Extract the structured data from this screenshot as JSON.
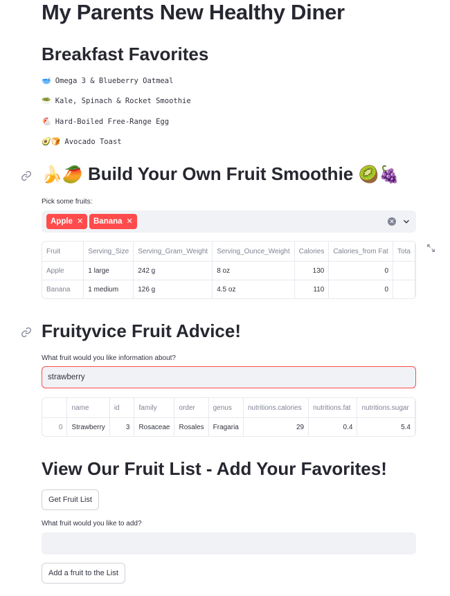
{
  "page_title": "My Parents New Healthy Diner",
  "breakfast": {
    "heading": "Breakfast Favorites",
    "items": [
      {
        "emoji": "🥣",
        "text": "Omega 3 & Blueberry Oatmeal"
      },
      {
        "emoji": "🥗",
        "text": "Kale, Spinach & Rocket Smoothie"
      },
      {
        "emoji": "🐔",
        "text": "Hard-Boiled Free-Range Egg"
      },
      {
        "emoji": "🥑🍞",
        "text": "Avocado Toast"
      }
    ]
  },
  "smoothie": {
    "heading_emoji_left": "🍌🥭",
    "heading": "Build Your Own Fruit Smoothie",
    "heading_emoji_right": "🥝🍇",
    "picker_label": "Pick some fruits:",
    "selected": [
      "Apple",
      "Banana"
    ],
    "table": {
      "columns": [
        "Fruit",
        "Serving_Size",
        "Serving_Gram_Weight",
        "Serving_Ounce_Weight",
        "Calories",
        "Calories_from Fat",
        "Tota"
      ],
      "rows": [
        [
          "Apple",
          "1 large",
          "242 g",
          "8 oz",
          "130",
          "0",
          ""
        ],
        [
          "Banana",
          "1 medium",
          "126 g",
          "4.5 oz",
          "110",
          "0",
          ""
        ]
      ]
    }
  },
  "advice": {
    "heading": "Fruityvice Fruit Advice!",
    "input_label": "What fruit would you like information about?",
    "input_value": "strawberry",
    "table": {
      "columns": [
        "",
        "name",
        "id",
        "family",
        "order",
        "genus",
        "nutritions.calories",
        "nutritions.fat",
        "nutritions.sugar"
      ],
      "rows": [
        [
          "0",
          "Strawberry",
          "3",
          "Rosaceae",
          "Rosales",
          "Fragaria",
          "29",
          "0.4",
          "5.4"
        ]
      ]
    }
  },
  "fruit_list": {
    "heading": "View Our Fruit List - Add Your Favorites!",
    "get_button": "Get Fruit List",
    "add_label": "What fruit would you like to add?",
    "add_input_value": "",
    "add_button": "Add a fruit to the List"
  },
  "colors": {
    "accent": "#ff4b4b",
    "input_bg": "#f0f2f6",
    "text": "#31333f",
    "muted": "#808495"
  }
}
